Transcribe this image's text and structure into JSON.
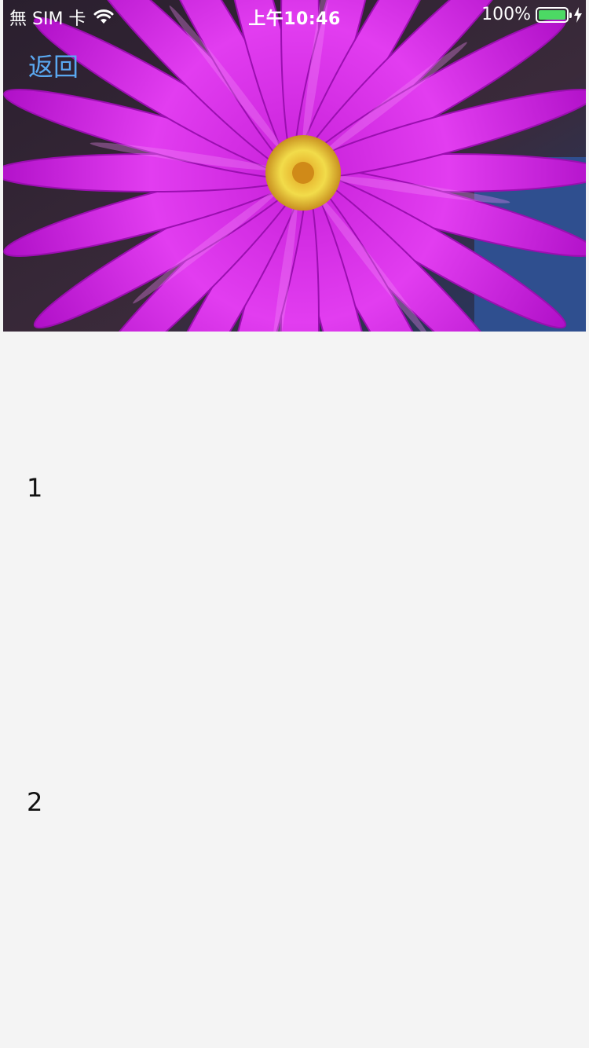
{
  "status_bar": {
    "carrier": "無 SIM 卡",
    "time": "上午10:46",
    "battery_percent": "100%",
    "battery_level": 1.0,
    "battery_color": "#4cd964",
    "icons": [
      "wifi-icon",
      "battery-icon",
      "charging-icon"
    ]
  },
  "nav": {
    "back_label": "返回",
    "back_color": "#5aa8f0"
  },
  "header_image": {
    "subject": "magenta flower"
  },
  "list": {
    "items": [
      "1",
      "2"
    ]
  }
}
